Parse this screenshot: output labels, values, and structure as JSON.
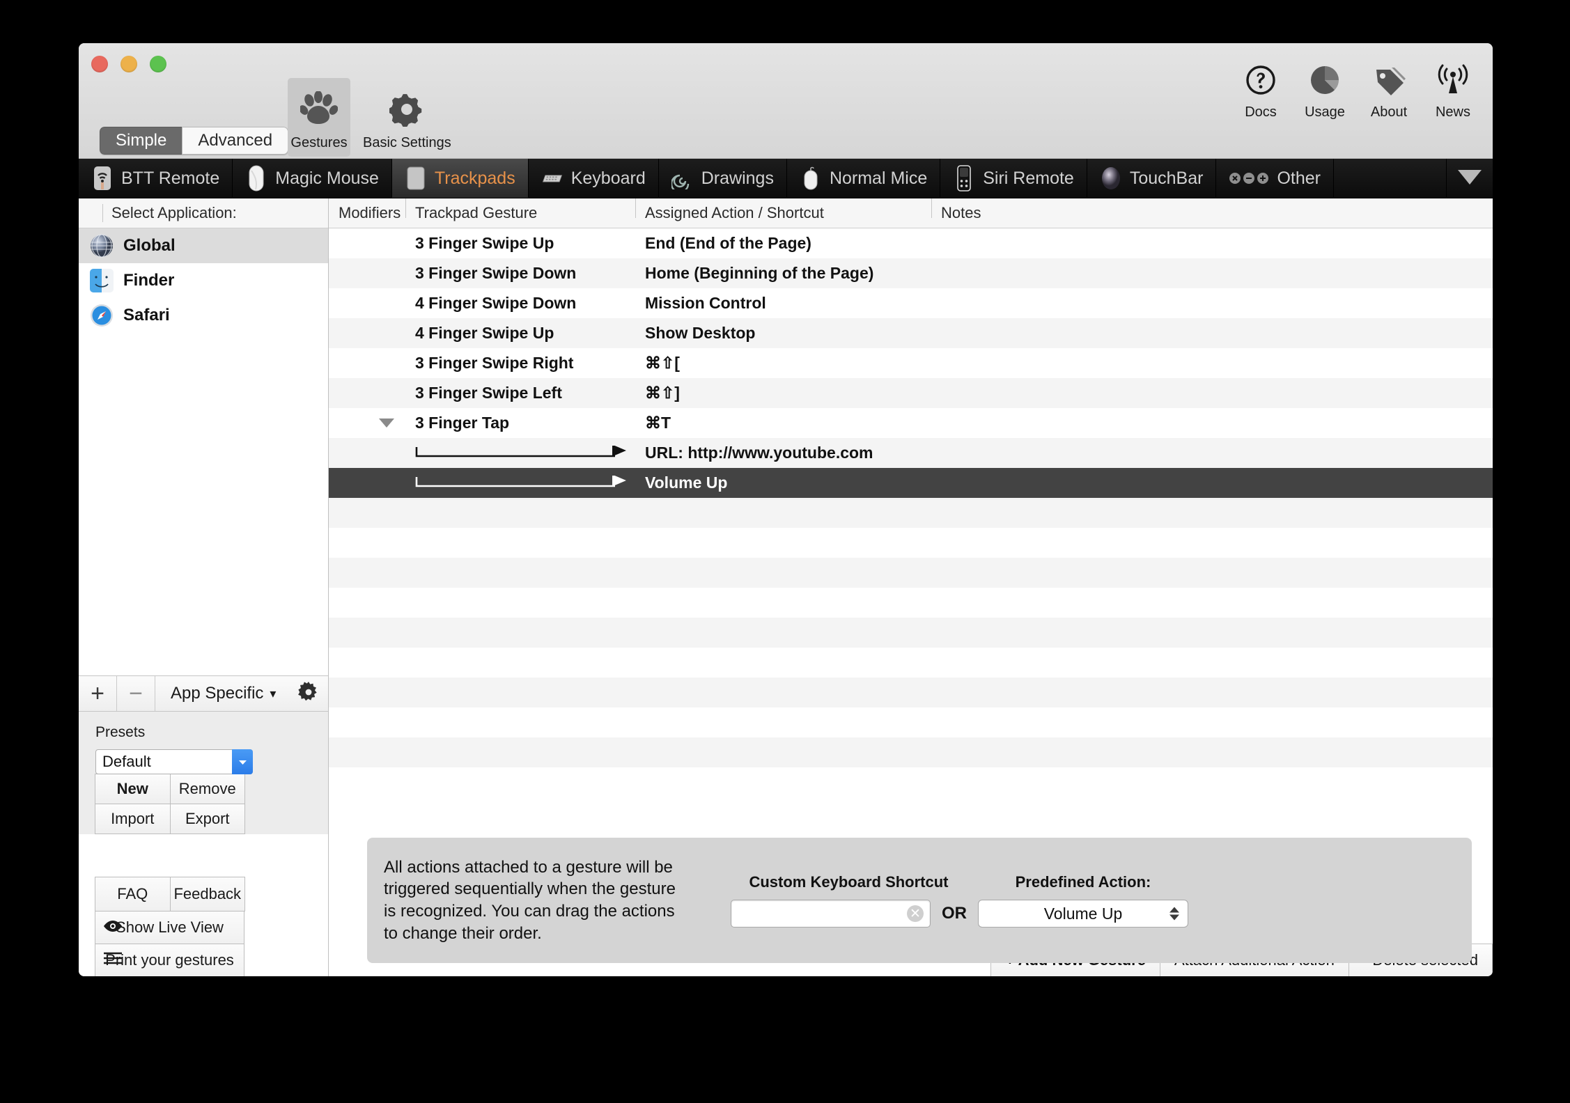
{
  "window": {
    "traffic_lights": [
      "close",
      "minimize",
      "zoom"
    ]
  },
  "toolbar": {
    "mode_segments": [
      {
        "label": "Simple",
        "active": true
      },
      {
        "label": "Advanced",
        "active": false
      }
    ],
    "mode_tabs": [
      {
        "label": "Gestures",
        "icon": "paw-icon",
        "active": true
      },
      {
        "label": "Basic Settings",
        "icon": "gear-icon",
        "active": false
      }
    ],
    "right_tools": [
      {
        "label": "Docs",
        "icon": "question-circle-icon"
      },
      {
        "label": "Usage",
        "icon": "pie-chart-icon"
      },
      {
        "label": "About",
        "icon": "tag-icon"
      },
      {
        "label": "News",
        "icon": "broadcast-icon"
      }
    ]
  },
  "device_tabs": [
    {
      "label": "BTT Remote",
      "icon": "btt-remote-icon",
      "active": false
    },
    {
      "label": "Magic Mouse",
      "icon": "magic-mouse-icon",
      "active": false
    },
    {
      "label": "Trackpads",
      "icon": "trackpad-icon",
      "active": true
    },
    {
      "label": "Keyboard",
      "icon": "keyboard-icon",
      "active": false
    },
    {
      "label": "Drawings",
      "icon": "spiral-icon",
      "active": false
    },
    {
      "label": "Normal Mice",
      "icon": "mouse-icon",
      "active": false
    },
    {
      "label": "Siri Remote",
      "icon": "siri-remote-icon",
      "active": false
    },
    {
      "label": "TouchBar",
      "icon": "touchbar-icon",
      "active": false
    },
    {
      "label": "Other",
      "icon": "other-dots-icon",
      "active": false
    }
  ],
  "device_more_icon": "chevron-down-icon",
  "sidebar": {
    "header": "Select Application:",
    "apps": [
      {
        "label": "Global",
        "icon": "globe-icon",
        "selected": true
      },
      {
        "label": "Finder",
        "icon": "finder-icon",
        "selected": false
      },
      {
        "label": "Safari",
        "icon": "safari-icon",
        "selected": false
      }
    ],
    "add_label": "+",
    "remove_label": "−",
    "app_specific_label": "App Specific",
    "app_specific_caret": "▾",
    "gear_icon": "gear-icon",
    "presets_title": "Presets",
    "preset_selected": "Default",
    "preset_buttons": [
      {
        "label": "New",
        "bold": true
      },
      {
        "label": "Remove",
        "bold": false
      },
      {
        "label": "Import",
        "bold": false
      },
      {
        "label": "Export",
        "bold": false
      }
    ],
    "help_buttons": [
      {
        "label": "FAQ"
      },
      {
        "label": "Feedback"
      }
    ],
    "live_view_label": "Show Live View",
    "live_view_icon": "eye-icon",
    "print_label": "Print your gestures",
    "print_icon": "list-lines-icon"
  },
  "table": {
    "columns": [
      "Modifiers",
      "Trackpad Gesture",
      "Assigned Action / Shortcut",
      "Notes"
    ],
    "rows": [
      {
        "modifier": "",
        "gesture": "3 Finger Swipe Up",
        "action": "End (End of the Page)",
        "notes": "",
        "type": "gesture",
        "selected": false
      },
      {
        "modifier": "",
        "gesture": "3 Finger Swipe Down",
        "action": "Home (Beginning of the Page)",
        "notes": "",
        "type": "gesture",
        "selected": false
      },
      {
        "modifier": "",
        "gesture": "4 Finger Swipe Down",
        "action": "Mission Control",
        "notes": "",
        "type": "gesture",
        "selected": false
      },
      {
        "modifier": "",
        "gesture": "4 Finger Swipe Up",
        "action": "Show Desktop",
        "notes": "",
        "type": "gesture",
        "selected": false
      },
      {
        "modifier": "",
        "gesture": "3 Finger Swipe Right",
        "action": "⌘⇧[",
        "notes": "",
        "type": "gesture",
        "selected": false
      },
      {
        "modifier": "",
        "gesture": "3 Finger Swipe Left",
        "action": "⌘⇧]",
        "notes": "",
        "type": "gesture",
        "selected": false
      },
      {
        "modifier": "disclosure-open",
        "gesture": "3 Finger Tap",
        "action": "⌘T",
        "notes": "",
        "type": "gesture-expanded",
        "selected": false
      },
      {
        "modifier": "",
        "gesture": "",
        "action": "URL: http://www.youtube.com",
        "notes": "",
        "type": "child-action",
        "selected": false
      },
      {
        "modifier": "",
        "gesture": "",
        "action": "Volume Up",
        "notes": "",
        "type": "child-action",
        "selected": true
      }
    ],
    "empty_row_count": 9
  },
  "action_buttons": [
    {
      "label": "+ Add New Gesture",
      "bold": true
    },
    {
      "label": "Attach Additional Action",
      "bold": false
    },
    {
      "label": "- Delete selected",
      "bold": false
    }
  ],
  "info_panel": {
    "description": "All actions attached to a gesture will be triggered sequentially when the gesture is recognized. You can drag the actions to change their order.",
    "custom_shortcut_label": "Custom Keyboard Shortcut",
    "custom_shortcut_value": "",
    "custom_shortcut_clear_icon": "clear-circle-icon",
    "or_label": "OR",
    "predefined_label": "Predefined Action:",
    "predefined_value": "Volume Up"
  },
  "colors": {
    "accent_orange": "#e8924a",
    "selection_dark": "#434343",
    "dropdown_blue": "#2b7ce8"
  }
}
